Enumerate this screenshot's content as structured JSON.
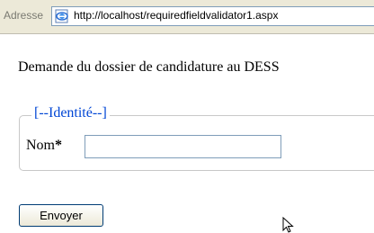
{
  "address_bar": {
    "label": "Adresse",
    "url": "http://localhost/requiredfieldvalidator1.aspx",
    "icon": "ie-page-icon"
  },
  "form": {
    "heading": "Demande du dossier de candidature au DESS",
    "legend": "[--Identité--]",
    "nom_label": "Nom",
    "nom_required_marker": "*",
    "nom_value": "",
    "submit_label": "Envoyer"
  },
  "colors": {
    "legend": "#0046d5",
    "input_border": "#7f9db9",
    "toolbar_bg": "#ece9d8"
  },
  "cursor": {
    "icon": "arrow-cursor-icon"
  }
}
